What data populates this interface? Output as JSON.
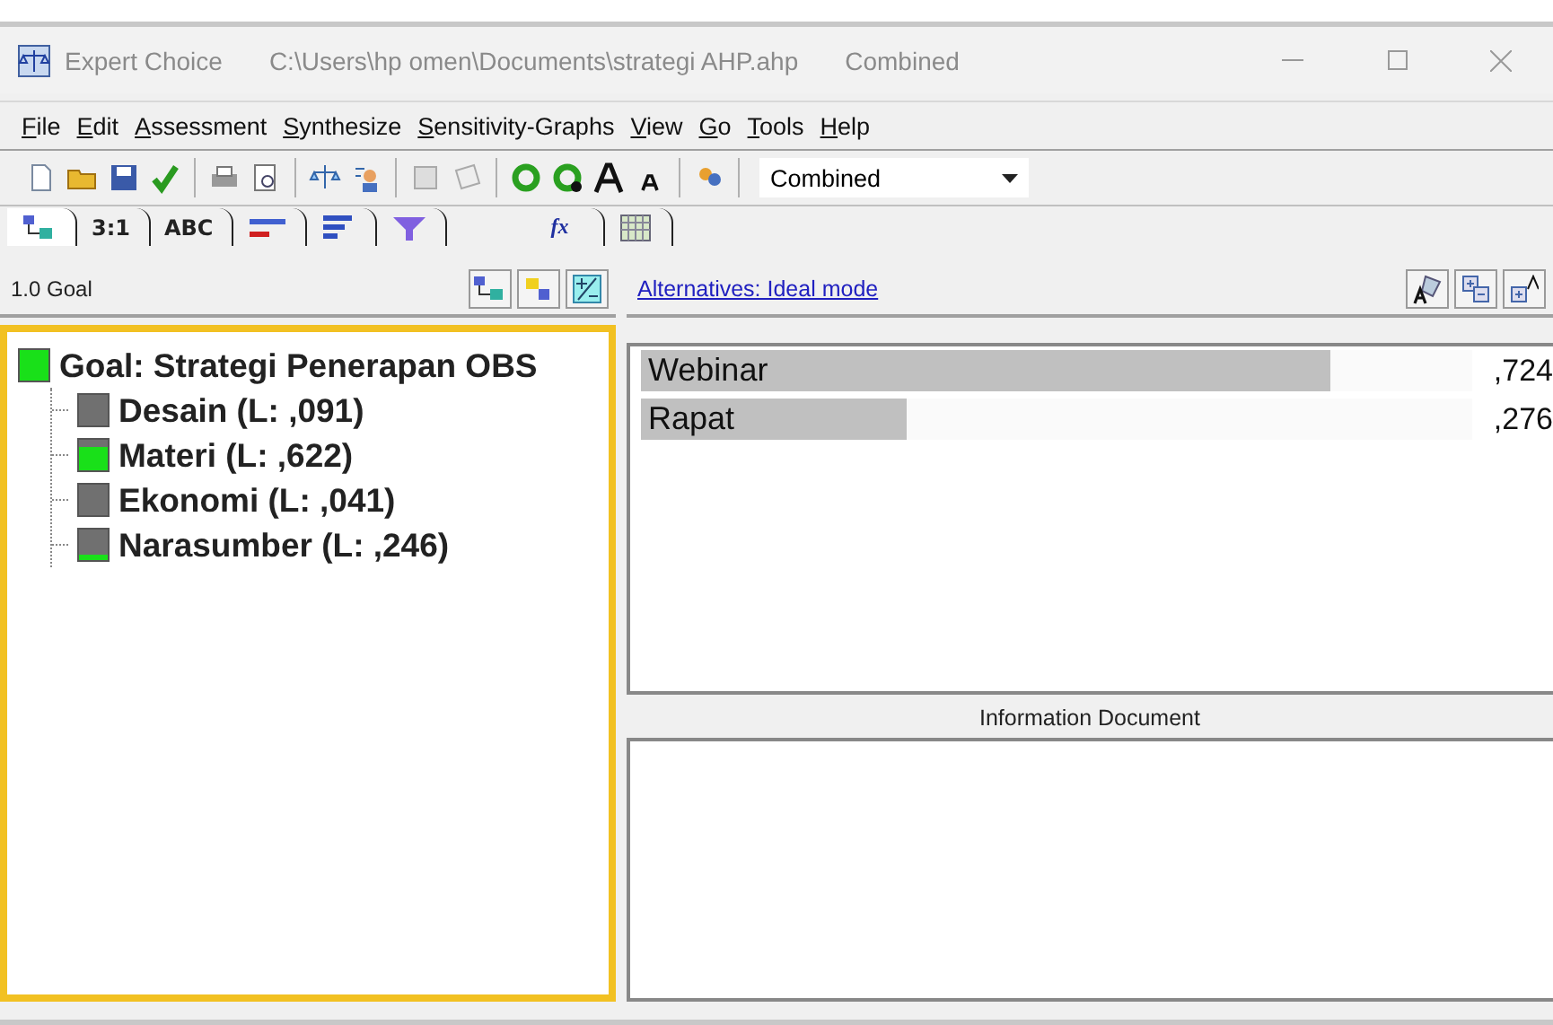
{
  "window": {
    "app_name": "Expert Choice",
    "file_path": "C:\\Users\\hp omen\\Documents\\strategi AHP.ahp",
    "mode": "Combined"
  },
  "menu": [
    "File",
    "Edit",
    "Assessment",
    "Synthesize",
    "Sensitivity-Graphs",
    "View",
    "Go",
    "Tools",
    "Help"
  ],
  "toolbar": {
    "combo_value": "Combined"
  },
  "tabs": [
    {
      "kind": "tree",
      "selected": true
    },
    {
      "kind": "text",
      "label": "3:1",
      "selected": false
    },
    {
      "kind": "text",
      "label": "ABC",
      "selected": false
    },
    {
      "kind": "bars",
      "selected": false
    },
    {
      "kind": "lines",
      "selected": false
    },
    {
      "kind": "funnel",
      "selected": false
    },
    {
      "kind": "formula",
      "label": "fx",
      "selected": false
    },
    {
      "kind": "grid",
      "selected": false
    }
  ],
  "tree": {
    "header": "1.0 Goal",
    "root": {
      "label": "Goal: Strategi Penerapan OBS",
      "level": 1,
      "children": [
        {
          "label": "Desain (L: ,091)",
          "level": 0
        },
        {
          "label": "Materi (L: ,622)",
          "level": 0.75
        },
        {
          "label": "Ekonomi (L: ,041)",
          "level": 0
        },
        {
          "label": "Narasumber (L: ,246)",
          "level": 0.2
        }
      ]
    }
  },
  "results": {
    "link": "Alternatives: Ideal mode",
    "alternatives": [
      {
        "name": "Webinar",
        "value": ",724",
        "level": 0.83
      },
      {
        "name": "Rapat",
        "value": ",276",
        "level": 0.32
      }
    ]
  },
  "information_document": {
    "title": "Information Document"
  }
}
